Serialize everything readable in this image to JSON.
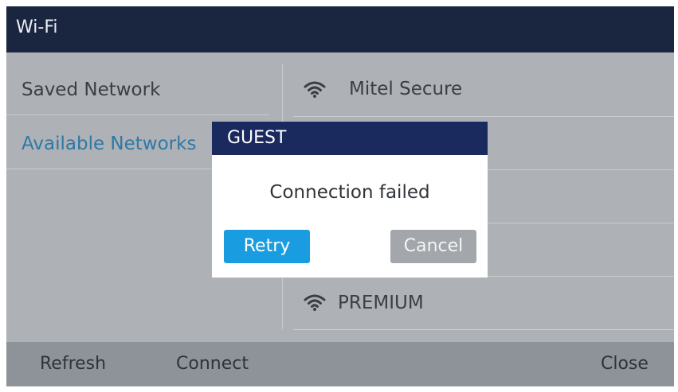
{
  "window": {
    "title": "Wi-Fi"
  },
  "sidebar": {
    "items": [
      {
        "label": "Saved Network"
      },
      {
        "label": "Available Networks"
      }
    ]
  },
  "networks": [
    {
      "name": "Mitel Secure",
      "icon": "wifi-icon"
    },
    {
      "name": "PREMIUM",
      "icon": "wifi-icon"
    }
  ],
  "dialog": {
    "title": "GUEST",
    "message": "Connection failed",
    "retry_label": "Retry",
    "cancel_label": "Cancel"
  },
  "softkeys": {
    "refresh": "Refresh",
    "connect": "Connect",
    "close": "Close"
  },
  "colors": {
    "titlebar": "#1a2540",
    "dialog_header": "#1a2a5e",
    "accent_text": "#2f78a6",
    "retry_button": "#1a9de0",
    "cancel_button": "#a3a7ab"
  }
}
